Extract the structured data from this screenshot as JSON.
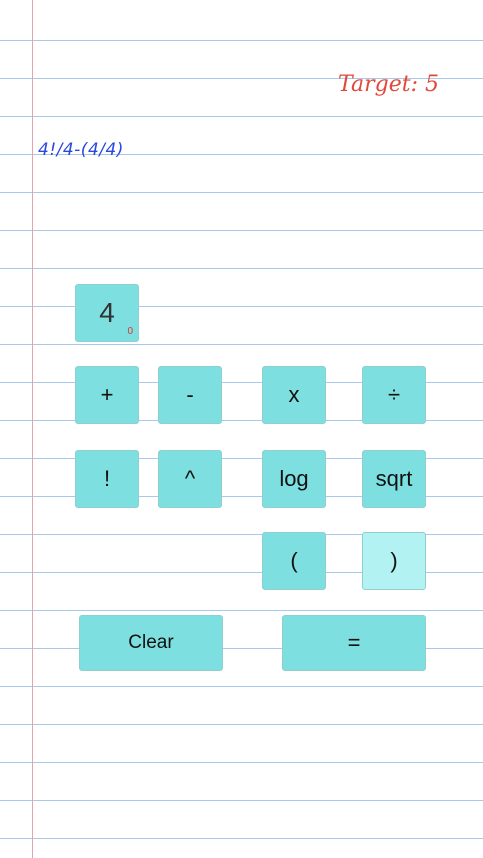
{
  "target": "Target: 5",
  "expression": "4!/4-(4/4)",
  "number_tile": {
    "value": "4",
    "count": "0"
  },
  "operators": {
    "plus": "+",
    "minus": "-",
    "times": "x",
    "divide": "÷",
    "factorial": "!",
    "power": "^",
    "log": "log",
    "sqrt": "sqrt",
    "open_paren": "(",
    "close_paren": ")"
  },
  "clear_label": "Clear",
  "equals_label": "="
}
